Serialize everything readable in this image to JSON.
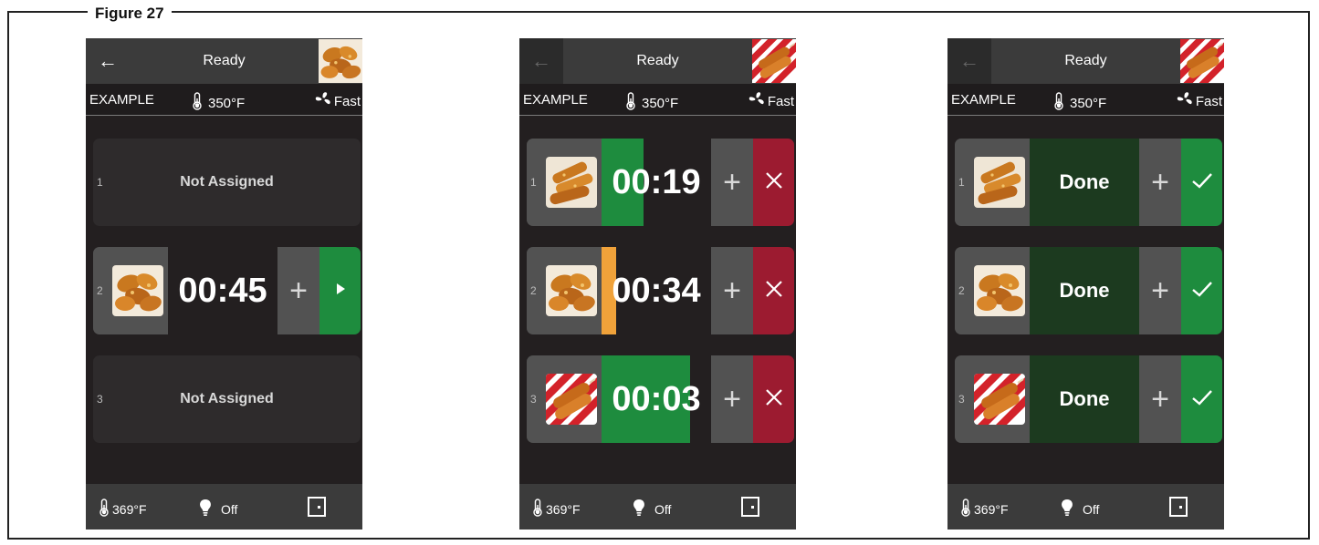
{
  "figure_title": "Figure 27",
  "colors": {
    "screen_bg": "#231f20",
    "bar_bg": "#3b3b3b",
    "start_green": "#1e8c3e",
    "cancel_red": "#9c1b30",
    "done_bg": "#1c3a1f",
    "progress_green": "#1e8c3e",
    "progress_orange": "#f0a23a"
  },
  "screens": [
    {
      "state": "Ready",
      "product_name": "EXAMPLE",
      "set_temp": "350°F",
      "fan": "Fast",
      "back_enabled": true,
      "top_thumb": "chicken-nuggets",
      "slots": [
        {
          "num": "1",
          "status": "empty",
          "label": "Not Assigned"
        },
        {
          "num": "2",
          "status": "loaded",
          "thumb": "chicken-nuggets",
          "time": "00:45",
          "plus": "+",
          "action": "play"
        },
        {
          "num": "3",
          "status": "empty",
          "label": "Not Assigned"
        }
      ],
      "actual_temp": "369°F",
      "light": "Off"
    },
    {
      "state": "Ready",
      "product_name": "EXAMPLE",
      "set_temp": "350°F",
      "fan": "Fast",
      "back_enabled": false,
      "top_thumb": "corn-dogs",
      "slots": [
        {
          "num": "1",
          "status": "cooking",
          "thumb": "chicken-strips",
          "time": "00:19",
          "plus": "+",
          "action": "cancel",
          "progress": 0.38,
          "progress_color": "#1e8c3e"
        },
        {
          "num": "2",
          "status": "cooking",
          "thumb": "chicken-nuggets",
          "time": "00:34",
          "plus": "+",
          "action": "cancel",
          "progress": 0.13,
          "progress_color": "#f0a23a"
        },
        {
          "num": "3",
          "status": "cooking",
          "thumb": "corn-dogs",
          "time": "00:03",
          "plus": "+",
          "action": "cancel",
          "progress": 0.81,
          "progress_color": "#1e8c3e"
        }
      ],
      "actual_temp": "369°F",
      "light": "Off"
    },
    {
      "state": "Ready",
      "product_name": "EXAMPLE",
      "set_temp": "350°F",
      "fan": "Fast",
      "back_enabled": false,
      "top_thumb": "corn-dogs",
      "slots": [
        {
          "num": "1",
          "status": "done",
          "thumb": "chicken-strips",
          "label": "Done",
          "plus": "+",
          "action": "confirm"
        },
        {
          "num": "2",
          "status": "done",
          "thumb": "chicken-nuggets",
          "label": "Done",
          "plus": "+",
          "action": "confirm"
        },
        {
          "num": "3",
          "status": "done",
          "thumb": "corn-dogs",
          "label": "Done",
          "plus": "+",
          "action": "confirm"
        }
      ],
      "actual_temp": "369°F",
      "light": "Off"
    }
  ]
}
